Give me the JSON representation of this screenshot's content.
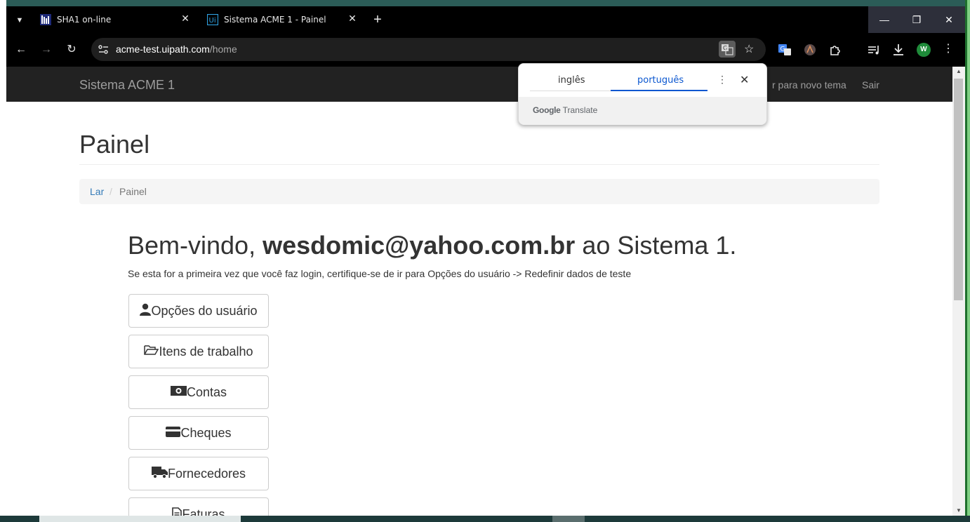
{
  "browser": {
    "tabs": [
      {
        "title": "SHA1 on-line",
        "favicon": "sha1-favicon-icon",
        "active": false
      },
      {
        "title": "Sistema ACME 1 - Painel",
        "favicon": "uipath-favicon-icon",
        "active": true
      }
    ],
    "url_host": "acme-test.uipath.com",
    "url_path": "/home",
    "profile_initial": "W"
  },
  "translate_popup": {
    "source_language": "inglês",
    "target_language": "português",
    "brand_google": "Google",
    "brand_translate": "Translate"
  },
  "navbar": {
    "brand": "Sistema ACME 1",
    "items": [
      {
        "label": "r para novo tema"
      },
      {
        "label": "Sair"
      }
    ]
  },
  "main": {
    "title": "Painel",
    "breadcrumb": {
      "home": "Lar",
      "separator": "/",
      "current": "Painel"
    },
    "welcome_prefix": "Bem-vindo,",
    "welcome_email": "wesdomic@yahoo.com.br",
    "welcome_suffix": "ao Sistema 1.",
    "note": "Se esta for a primeira vez que você faz login, certifique-se de ir para Opções do usuário -> Redefinir dados de teste",
    "actions": [
      {
        "label": "Opções do usuário",
        "icon": "user-icon"
      },
      {
        "label": "Itens de trabalho",
        "icon": "folder-open-icon"
      },
      {
        "label": "Contas",
        "icon": "money-icon"
      },
      {
        "label": "Cheques",
        "icon": "credit-card-icon"
      },
      {
        "label": "Fornecedores",
        "icon": "truck-icon"
      },
      {
        "label": "Faturas",
        "icon": "file-icon"
      }
    ]
  },
  "colors": {
    "navbar_bg": "#222222",
    "link": "#337ab7",
    "translate_accent": "#0b57d0",
    "profile": "#1f8b3a"
  }
}
